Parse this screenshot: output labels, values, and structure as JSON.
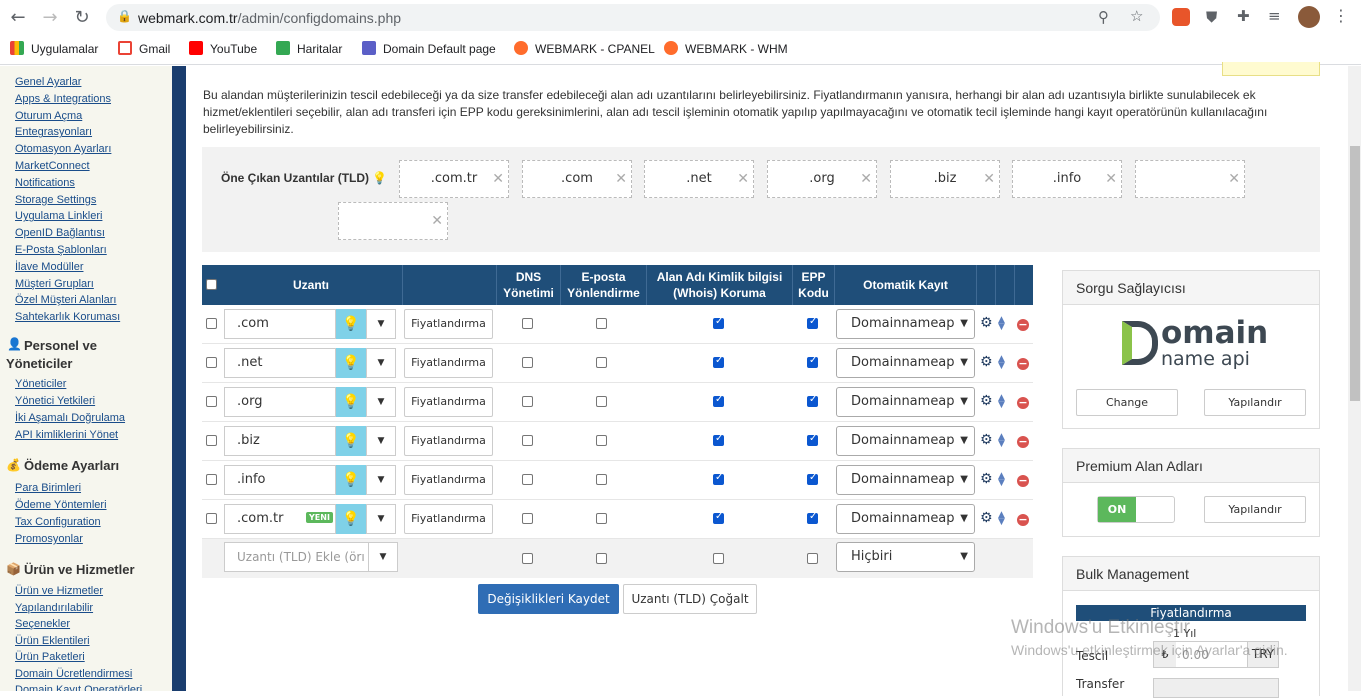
{
  "browser": {
    "url_host": "webmark.com.tr",
    "url_path": "/admin/configdomains.php",
    "bookmarks": [
      "Uygulamalar",
      "Gmail",
      "YouTube",
      "Haritalar",
      "Domain Default page",
      "WEBMARK - CPANEL",
      "WEBMARK - WHM"
    ]
  },
  "sidebar": {
    "group1_links": [
      "Genel Ayarlar",
      "Apps & Integrations",
      "Oturum Açma",
      "Entegrasyonları",
      "Otomasyon Ayarları",
      "MarketConnect",
      "Notifications",
      "Storage Settings",
      "Uygulama Linkleri",
      "OpenID Bağlantısı",
      "E-Posta Şablonları",
      "İlave Modüller",
      "Müşteri Grupları",
      "Özel Müşteri Alanları",
      "Sahtekarlık Koruması"
    ],
    "heading_personel_1": "Personel ve",
    "heading_personel_2": "Yöneticiler",
    "group2_links": [
      "Yöneticiler",
      "Yönetici Yetkileri",
      "İki Aşamalı Doğrulama",
      "API kimliklerini Yönet"
    ],
    "heading_odeme": "Ödeme Ayarları",
    "group3_links": [
      "Para Birimleri",
      "Ödeme Yöntemleri",
      "Tax Configuration",
      "Promosyonlar"
    ],
    "heading_urun": "Ürün ve Hizmetler",
    "group4_links": [
      "Ürün ve Hizmetler",
      "Yapılandırılabilir",
      "Seçenekler",
      "Ürün Eklentileri",
      "Ürün Paketleri",
      "Domain Ücretlendirmesi",
      "Domain Kayıt Operatörleri"
    ]
  },
  "main": {
    "description": "Bu alandan müşterilerinizin tescil edebileceği ya da size transfer edebileceği alan adı uzantılarını belirleyebilirsiniz. Fiyatlandırmanın yanısıra, herhangi bir alan adı uzantısıyla birlikte sunulabilecek ek hizmet/eklentileri seçebilir, alan adı transferi için EPP kodu gereksinimlerini, alan adı tescil işleminin otomatik yapılıp yapılmayacağını ve otomatik tecil işleminde hangi kayıt operatörünün kullanılacağını belirleyebilirsiniz.",
    "featured_label": "Öne Çıkan Uzantılar (TLD)",
    "featured_tlds": [
      ".com.tr",
      ".com",
      ".net",
      ".org",
      ".biz",
      ".info",
      "",
      ""
    ],
    "table_headers": {
      "uzanti": "Uzantı",
      "dns_1": "DNS",
      "dns_2": "Yönetimi",
      "eposta_1": "E-posta",
      "eposta_2": "Yönlendirme",
      "whois_1": "Alan Adı Kimlik bilgisi",
      "whois_2": "(Whois) Koruma",
      "epp_1": "EPP",
      "epp_2": "Kodu",
      "auto": "Otomatik Kayıt"
    },
    "rows": [
      {
        "tld": ".com",
        "pricing": "Fiyatlandırma",
        "dns": false,
        "email": false,
        "whois": true,
        "epp": true,
        "registrar": "Domainnameap",
        "new": ""
      },
      {
        "tld": ".net",
        "pricing": "Fiyatlandırma",
        "dns": false,
        "email": false,
        "whois": true,
        "epp": true,
        "registrar": "Domainnameap",
        "new": ""
      },
      {
        "tld": ".org",
        "pricing": "Fiyatlandırma",
        "dns": false,
        "email": false,
        "whois": true,
        "epp": true,
        "registrar": "Domainnameap",
        "new": ""
      },
      {
        "tld": ".biz",
        "pricing": "Fiyatlandırma",
        "dns": false,
        "email": false,
        "whois": true,
        "epp": true,
        "registrar": "Domainnameap",
        "new": ""
      },
      {
        "tld": ".info",
        "pricing": "Fiyatlandırma",
        "dns": false,
        "email": false,
        "whois": true,
        "epp": true,
        "registrar": "Domainnameap",
        "new": ""
      },
      {
        "tld": ".com.tr",
        "pricing": "Fiyatlandırma",
        "dns": false,
        "email": false,
        "whois": true,
        "epp": true,
        "registrar": "Domainnameap",
        "new": "YENI"
      }
    ],
    "add_row": {
      "placeholder": "Uzantı (TLD) Ekle (örı",
      "registrar": "Hiçbiri"
    },
    "save_button": "Değişiklikleri Kaydet",
    "duplicate_button": "Uzantı (TLD) Çoğalt"
  },
  "panels": {
    "lookup_title": "Sorgu Sağlayıcısı",
    "logo_big": "omain",
    "logo_small": "name api",
    "change_button": "Change",
    "configure_button": "Yapılandır",
    "premium_title": "Premium Alan Adları",
    "toggle_on": "ON",
    "premium_configure": "Yapılandır",
    "bulk_title": "Bulk Management",
    "bulk_tab": "Fiyatlandırma",
    "bulk_year": "1 Yıl",
    "bulk_tescil": "Tescil",
    "bulk_currency_symbol": "₺",
    "bulk_amount": "0.00",
    "bulk_currency": "TRY",
    "bulk_transfer": "Transfer"
  },
  "watermark": {
    "line1": "Windows'u Etkinleştir",
    "line2": "Windows'u etkinleştirmek için Ayarlar'a gidin."
  }
}
